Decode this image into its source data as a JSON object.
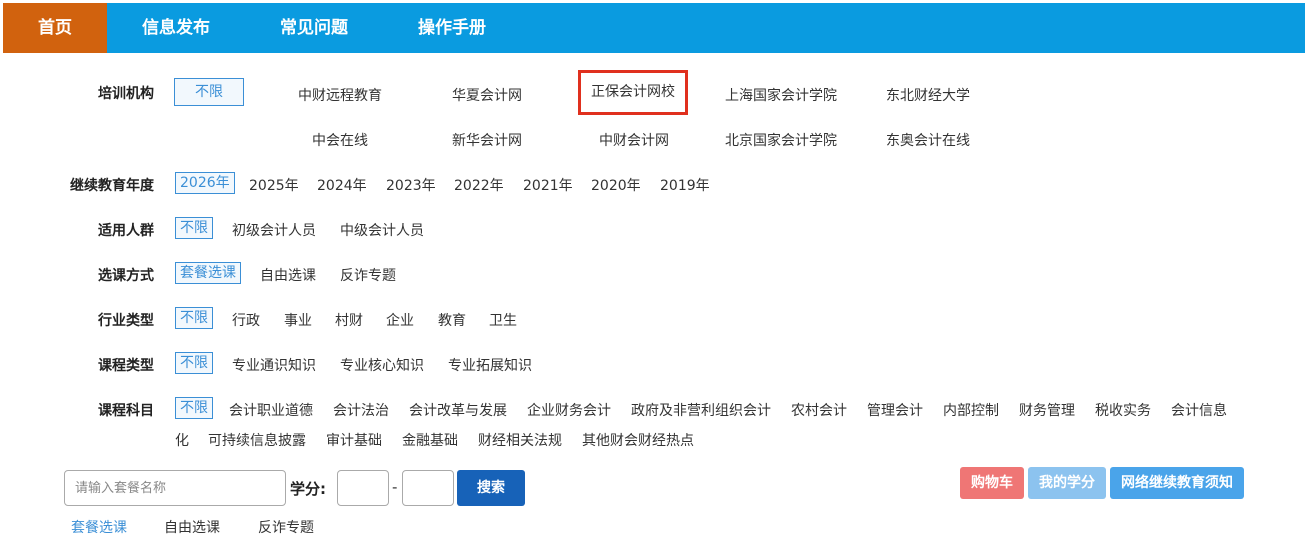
{
  "nav": [
    "首页",
    "信息发布",
    "常见问题",
    "操作手册"
  ],
  "filters": {
    "institution": {
      "label": "培训机构",
      "options": [
        "不限",
        "中财远程教育",
        "华夏会计网",
        "正保会计网校",
        "上海国家会计学院",
        "东北财经大学",
        "中会在线",
        "新华会计网",
        "中财会计网",
        "北京国家会计学院",
        "东奥会计在线"
      ]
    },
    "year": {
      "label": "继续教育年度",
      "options": [
        "2026年",
        "2025年",
        "2024年",
        "2023年",
        "2022年",
        "2021年",
        "2020年",
        "2019年"
      ]
    },
    "audience": {
      "label": "适用人群",
      "options": [
        "不限",
        "初级会计人员",
        "中级会计人员"
      ]
    },
    "mode": {
      "label": "选课方式",
      "options": [
        "套餐选课",
        "自由选课",
        "反诈专题"
      ]
    },
    "industry": {
      "label": "行业类型",
      "options": [
        "不限",
        "行政",
        "事业",
        "村财",
        "企业",
        "教育",
        "卫生"
      ]
    },
    "course_type": {
      "label": "课程类型",
      "options": [
        "不限",
        "专业通识知识",
        "专业核心知识",
        "专业拓展知识"
      ]
    },
    "subject": {
      "label": "课程科目",
      "options": [
        "不限",
        "会计职业道德",
        "会计法治",
        "会计改革与发展",
        "企业财务会计",
        "政府及非营利组织会计",
        "农村会计",
        "管理会计",
        "内部控制",
        "财务管理",
        "税收实务",
        "会计信息",
        "化",
        "可持续信息披露",
        "审计基础",
        "金融基础",
        "财经相关法规",
        "其他财会财经热点"
      ]
    }
  },
  "search": {
    "placeholder": "请输入套餐名称",
    "credit_label": "学分:",
    "dash": "-",
    "button": "搜索"
  },
  "actions": {
    "cart": "购物车",
    "my_credit": "我的学分",
    "notice": "网络继续教育须知"
  },
  "bottom_tabs": [
    "套餐选课",
    "自由选课",
    "反诈专题"
  ]
}
